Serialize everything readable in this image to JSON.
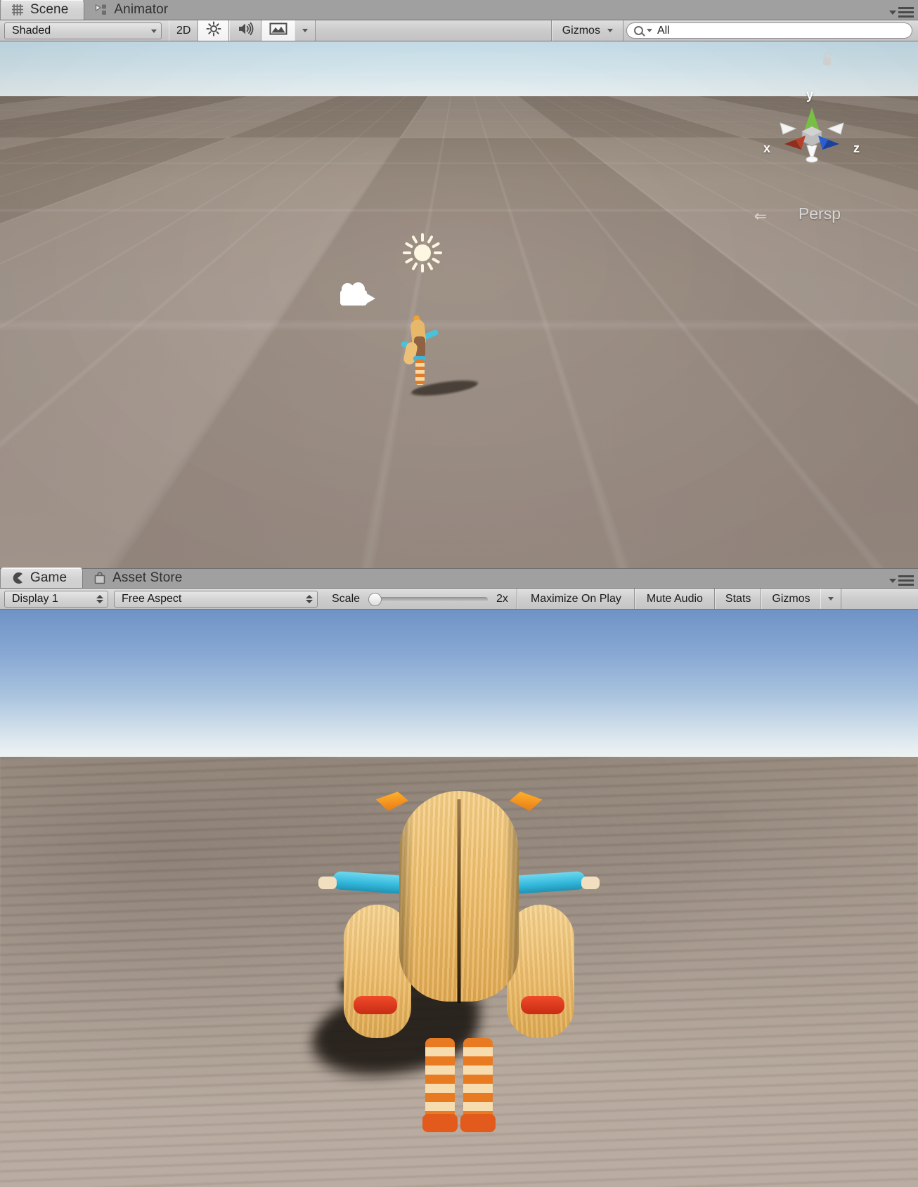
{
  "scene_panel": {
    "tabs": [
      {
        "label": "Scene",
        "icon": "grid-icon",
        "active": true
      },
      {
        "label": "Animator",
        "icon": "animator-nodes-icon",
        "active": false
      }
    ],
    "tabstrip_menu_icon": "panel-options-hamburger-icon",
    "toolbar": {
      "draw_mode": "Shaded",
      "two_d_toggle": "2D",
      "lighting_icon": "sun-lighting-icon",
      "audio_icon": "speaker-audio-icon",
      "effects_icon": "image-effects-icon",
      "effects_dropdown_icon": "chevron-down-icon",
      "gizmos_label": "Gizmos",
      "gizmos_dropdown_icon": "chevron-down-icon",
      "search_placeholder": "All",
      "search_value": "All",
      "search_icon": "search-magnifier-icon"
    },
    "viewport": {
      "view_gizmo": {
        "axis_x_label": "x",
        "axis_y_label": "y",
        "axis_z_label": "z",
        "x_color": "#b5402a",
        "y_color": "#77c043",
        "z_color": "#2a5fd0",
        "neg_axis_color": "#f2f2f2",
        "center_color": "#b9b9b9"
      },
      "projection_label": "Persp",
      "projection_arrow_icon": "chevron-left-icon",
      "lock_icon": "unlocked-padlock-icon",
      "gizmos": [
        {
          "name": "directional-light-gizmo",
          "icon": "sun-icon"
        },
        {
          "name": "camera-gizmo",
          "icon": "movie-camera-icon"
        }
      ],
      "sky_color": "#dcf0f8",
      "ground_color": "#a4958a"
    }
  },
  "game_panel": {
    "tabs": [
      {
        "label": "Game",
        "icon": "game-pacman-icon",
        "active": true
      },
      {
        "label": "Asset Store",
        "icon": "shopping-bag-icon",
        "active": false
      }
    ],
    "tabstrip_menu_icon": "panel-options-hamburger-icon",
    "toolbar": {
      "display": "Display 1",
      "display_stepper_icon": "updown-stepper-icon",
      "aspect": "Free Aspect",
      "aspect_stepper_icon": "updown-stepper-icon",
      "scale_label": "Scale",
      "scale_value": "2x",
      "scale_slider_percent": 4,
      "maximize_on_play": "Maximize On Play",
      "mute_audio": "Mute Audio",
      "stats": "Stats",
      "gizmos": "Gizmos",
      "gizmos_dropdown_icon": "chevron-down-icon"
    },
    "viewport": {
      "sky_top_color": "#6f93c6",
      "sky_bottom_color": "#eef2f1",
      "ground_color": "#b0a195",
      "character_name": "blonde-character-t-pose"
    }
  }
}
